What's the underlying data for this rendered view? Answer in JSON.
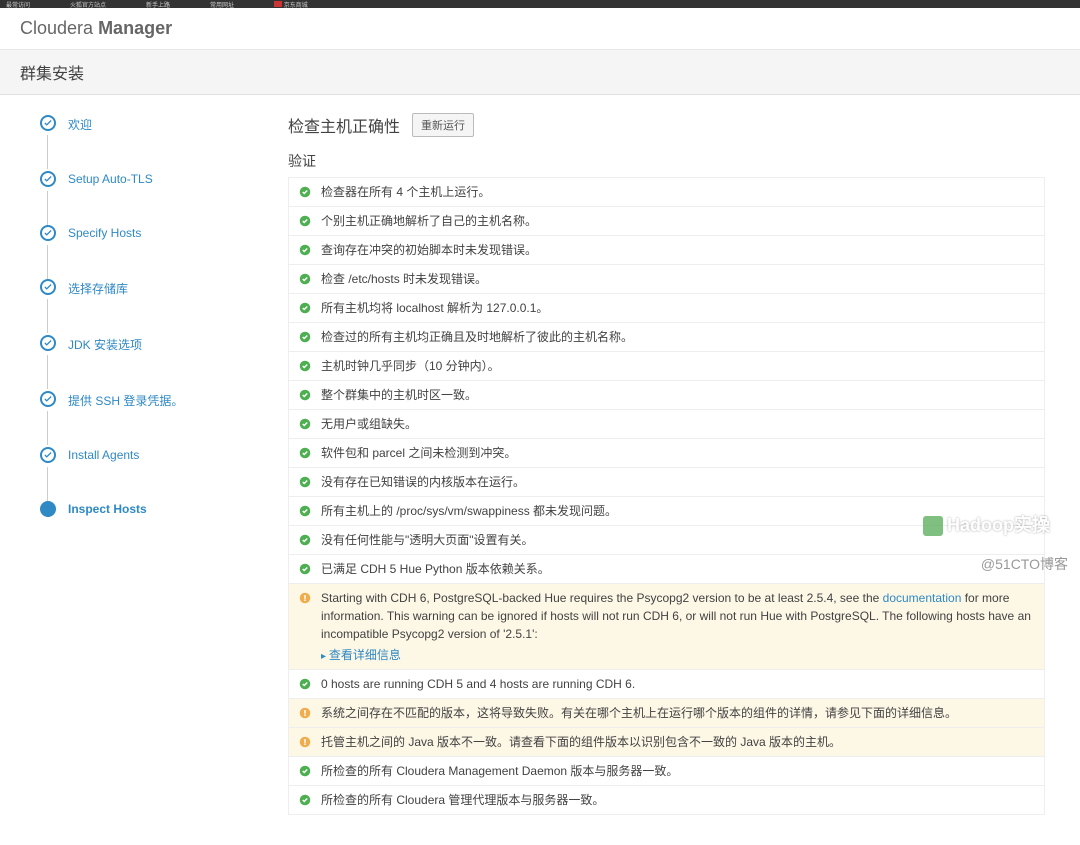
{
  "browser_tabs": [
    "最常访问",
    "火狐官方站点",
    "新手上路",
    "常用网址",
    "京东商城"
  ],
  "brand_prefix": "Cloudera",
  "brand_suffix": "Manager",
  "page_title": "群集安装",
  "steps": [
    {
      "label": "欢迎"
    },
    {
      "label": "Setup Auto-TLS"
    },
    {
      "label": "Specify Hosts"
    },
    {
      "label": "选择存储库"
    },
    {
      "label": "JDK 安装选项"
    },
    {
      "label": "提供 SSH 登录凭据。"
    },
    {
      "label": "Install Agents"
    },
    {
      "label": "Inspect Hosts"
    }
  ],
  "current_step_index": 7,
  "main_title": "检查主机正确性",
  "rerun_label": "重新运行",
  "section_title": "验证",
  "rows": [
    {
      "status": "ok",
      "text": "检查器在所有 4 个主机上运行。"
    },
    {
      "status": "ok",
      "text": "个别主机正确地解析了自己的主机名称。"
    },
    {
      "status": "ok",
      "text": "查询存在冲突的初始脚本时未发现错误。"
    },
    {
      "status": "ok",
      "text": "检查 /etc/hosts 时未发现错误。"
    },
    {
      "status": "ok",
      "text": "所有主机均将 localhost 解析为 127.0.0.1。"
    },
    {
      "status": "ok",
      "text": "检查过的所有主机均正确且及时地解析了彼此的主机名称。"
    },
    {
      "status": "ok",
      "text": "主机时钟几乎同步（10 分钟内）。"
    },
    {
      "status": "ok",
      "text": "整个群集中的主机时区一致。"
    },
    {
      "status": "ok",
      "text": "无用户或组缺失。"
    },
    {
      "status": "ok",
      "text": "软件包和 parcel 之间未检测到冲突。"
    },
    {
      "status": "ok",
      "text": "没有存在已知错误的内核版本在运行。"
    },
    {
      "status": "ok",
      "text": "所有主机上的 /proc/sys/vm/swappiness 都未发现问题。"
    },
    {
      "status": "ok",
      "text": "没有任何性能与\"透明大页面\"设置有关。"
    },
    {
      "status": "ok",
      "text": "已满足 CDH 5 Hue Python 版本依赖关系。"
    },
    {
      "status": "warn",
      "pre": "Starting with CDH 6, PostgreSQL-backed Hue requires the Psycopg2 version to be at least 2.5.4, see the ",
      "link": "documentation",
      "post": " for more information. This warning can be ignored if hosts will not run CDH 6, or will not run Hue with PostgreSQL. The following hosts have an incompatible Psycopg2 version of '2.5.1':",
      "more": "查看详细信息"
    },
    {
      "status": "ok",
      "text": "0 hosts are running CDH 5 and 4 hosts are running CDH 6."
    },
    {
      "status": "warn",
      "text": "系统之间存在不匹配的版本，这将导致失败。有关在哪个主机上在运行哪个版本的组件的详情，请参见下面的详细信息。"
    },
    {
      "status": "warn",
      "text": "托管主机之间的 Java 版本不一致。请查看下面的组件版本以识别包含不一致的 Java 版本的主机。"
    },
    {
      "status": "ok",
      "text": "所检查的所有 Cloudera Management Daemon 版本与服务器一致。"
    },
    {
      "status": "ok",
      "text": "所检查的所有 Cloudera 管理代理版本与服务器一致。"
    }
  ],
  "watermark_main": "Hadoop实操",
  "watermark_sub": "@51CTO博客"
}
